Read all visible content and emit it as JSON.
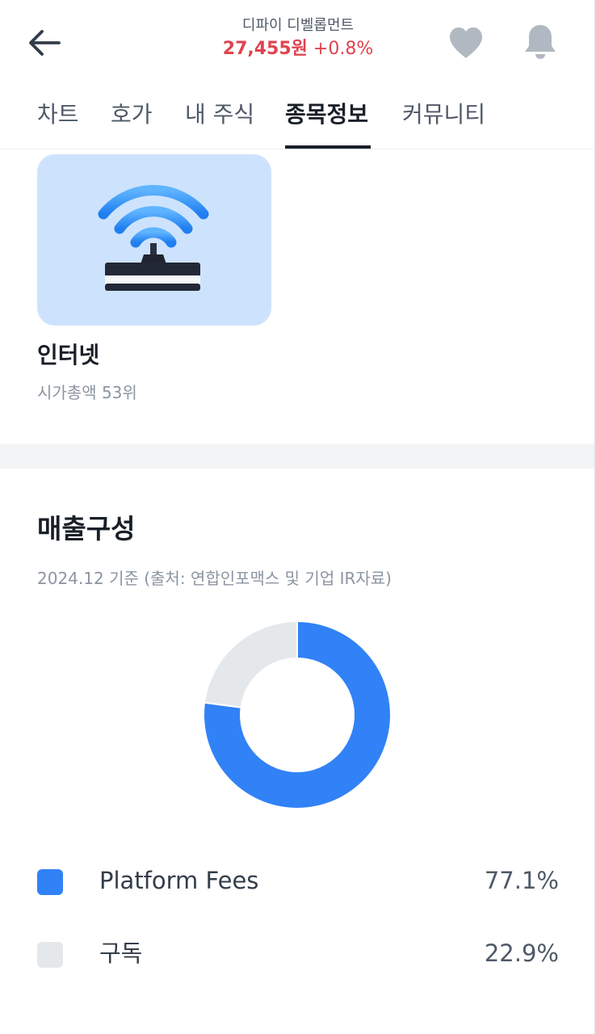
{
  "header": {
    "stock_name": "디파이 디벨롭먼트",
    "price": "27,455원",
    "change": "+0.8%"
  },
  "tabs": [
    {
      "label": "차트"
    },
    {
      "label": "호가"
    },
    {
      "label": "내 주식"
    },
    {
      "label": "종목정보",
      "active": true
    },
    {
      "label": "커뮤니티"
    }
  ],
  "category": {
    "name": "인터넷",
    "rank": "시가총액 53위",
    "icon": "wifi-router-icon"
  },
  "revenue": {
    "title": "매출구성",
    "subtitle": "2024.12 기준 (출처: 연합인포맥스 및 기업 IR자료)"
  },
  "chart_data": {
    "type": "pie",
    "style": "donut",
    "categories": [
      "Platform Fees",
      "구독"
    ],
    "values": [
      77.1,
      22.9
    ],
    "value_labels": [
      "77.1%",
      "22.9%"
    ],
    "colors": [
      "#3182f6",
      "#e5e8eb"
    ],
    "title": "매출구성",
    "legend_position": "bottom"
  },
  "colors": {
    "accent": "#3182f6",
    "price_up": "#e0434f",
    "muted": "#8b95a1"
  }
}
